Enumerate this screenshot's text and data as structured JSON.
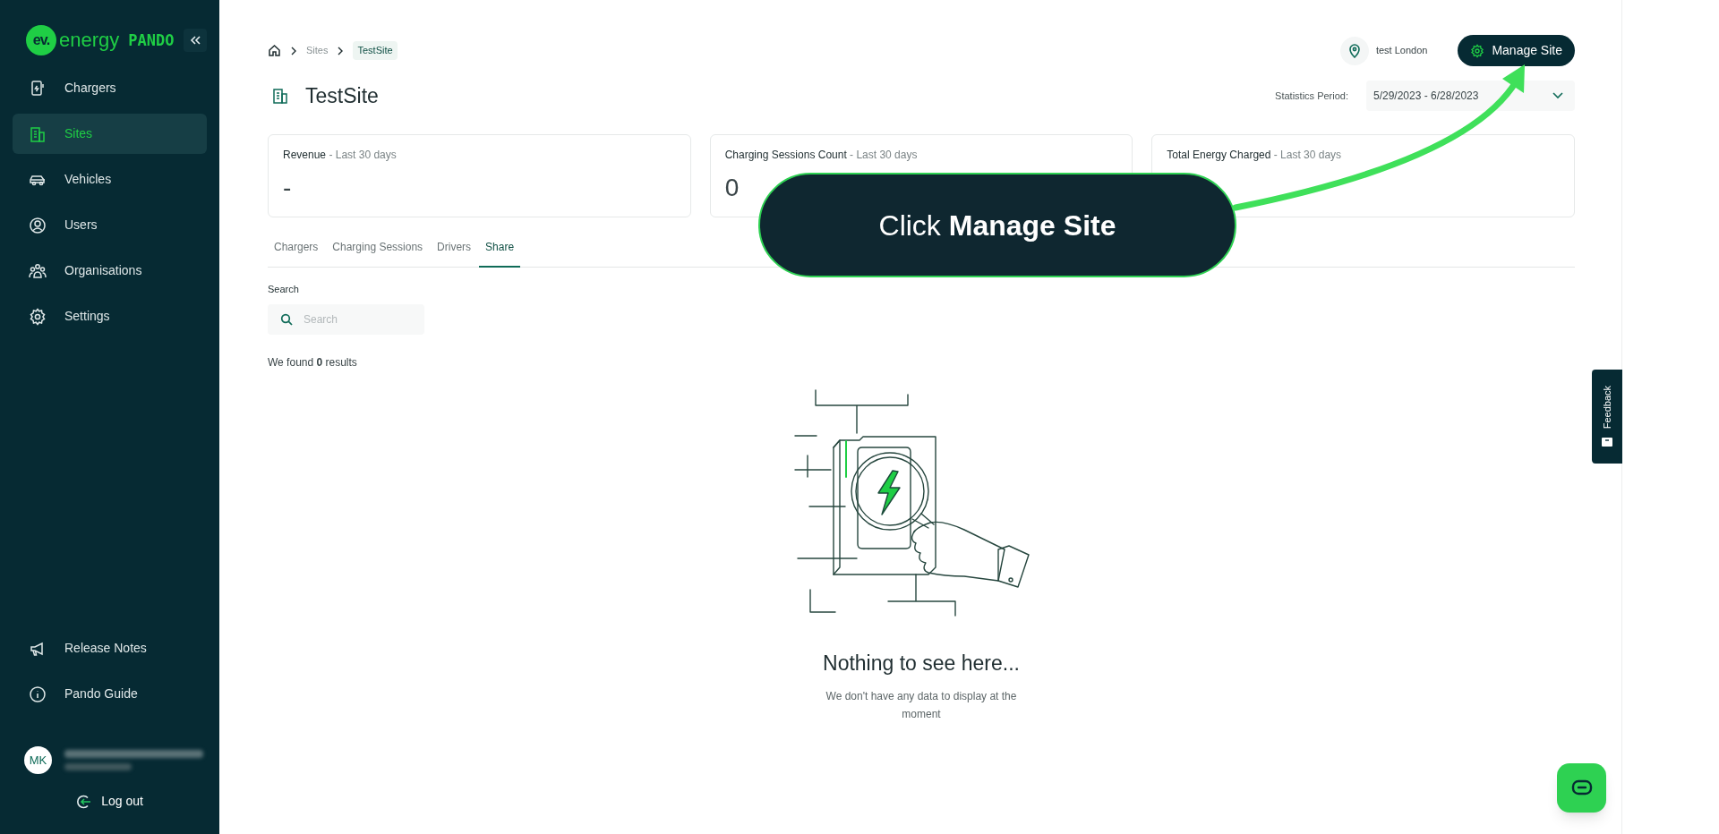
{
  "sidebar": {
    "logo": {
      "badge": "ev.",
      "wordmark": "energy",
      "product": "PANDO"
    },
    "nav_items": [
      {
        "label": "Chargers",
        "kind": "charger",
        "selected": false
      },
      {
        "label": "Sites",
        "kind": "building",
        "selected": true
      },
      {
        "label": "Vehicles",
        "kind": "car",
        "selected": false
      },
      {
        "label": "Users",
        "kind": "user",
        "selected": false
      },
      {
        "label": "Organisations",
        "kind": "people",
        "selected": false
      },
      {
        "label": "Settings",
        "kind": "gear",
        "selected": false
      }
    ],
    "footer_items": [
      {
        "label": "Release Notes",
        "kind": "megaphone"
      },
      {
        "label": "Pando Guide",
        "kind": "info"
      }
    ],
    "user": {
      "initials": "MK"
    },
    "logout": "Log out"
  },
  "header": {
    "breadcrumbs": [
      {
        "label": "Sites",
        "current": false
      },
      {
        "label": "TestSite",
        "current": true
      }
    ],
    "title": "TestSite",
    "location": "test London",
    "manage_button": "Manage Site",
    "statistics_label": "Statistics Period:",
    "period": "5/29/2023 - 6/28/2023"
  },
  "stat_cards": [
    {
      "title": "Revenue",
      "period": " - Last 30 days",
      "value": "-"
    },
    {
      "title": "Charging Sessions Count",
      "period": " - Last 30 days",
      "value": "0"
    },
    {
      "title": "Total Energy Charged",
      "period": " - Last 30 days"
    }
  ],
  "tabs": [
    {
      "label": "Chargers",
      "selected": false
    },
    {
      "label": "Charging Sessions",
      "selected": false
    },
    {
      "label": "Drivers",
      "selected": false
    },
    {
      "label": "Share",
      "selected": true
    }
  ],
  "search": {
    "label": "Search",
    "placeholder": "Search"
  },
  "results": "We found **0** results",
  "empty_state": {
    "title": "Nothing to see here...",
    "message": "We don't have any data to display at the moment"
  },
  "feedback_tab": "Feedback",
  "callout": "Click **Manage Site**"
}
